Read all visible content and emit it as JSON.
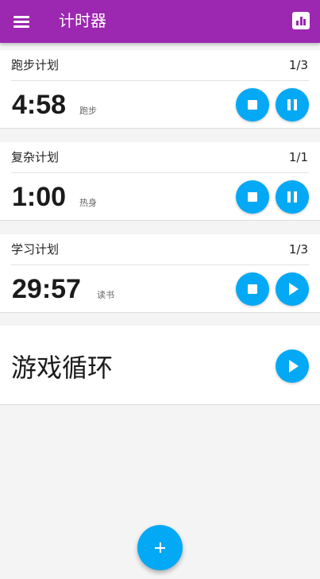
{
  "appbar": {
    "title": "计时器",
    "menu_icon": "menu-icon",
    "stats_icon": "bar-chart-icon",
    "color": "#9c27b0"
  },
  "accent": "#03a9f4",
  "timers": [
    {
      "title": "跑步计划",
      "progress": "1/3",
      "time": "4:58",
      "label": "跑步",
      "state": "running",
      "primary_icon": "pause-icon"
    },
    {
      "title": "复杂计划",
      "progress": "1/1",
      "time": "1:00",
      "label": "热身",
      "state": "running",
      "primary_icon": "pause-icon"
    },
    {
      "title": "学习计划",
      "progress": "1/3",
      "time": "29:57",
      "label": "读书",
      "state": "paused",
      "primary_icon": "play-icon"
    }
  ],
  "loop": {
    "title": "游戏循环",
    "icon": "play-icon"
  },
  "add_button": {
    "icon": "add-icon"
  }
}
